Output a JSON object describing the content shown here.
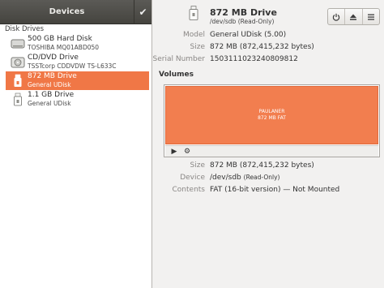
{
  "sidebar": {
    "title": "Devices",
    "section_label": "Disk Drives",
    "items": [
      {
        "name": "500 GB Hard Disk",
        "sub": "TOSHIBA MQ01ABD050",
        "icon": "hard-disk-icon"
      },
      {
        "name": "CD/DVD Drive",
        "sub": "TSSTcorp CDDVDW TS-L633C",
        "icon": "optical-drive-icon"
      },
      {
        "name": "872 MB Drive",
        "sub": "General UDisk",
        "icon": "usb-drive-icon",
        "selected": true
      },
      {
        "name": "1.1 GB Drive",
        "sub": "General UDisk",
        "icon": "usb-drive-icon"
      }
    ]
  },
  "drive": {
    "name": "872 MB Drive",
    "path": "/dev/sdb",
    "path_note": "(Read-Only)"
  },
  "details": {
    "model_label": "Model",
    "model": "General UDisk (5.00)",
    "size_label": "Size",
    "size": "872 MB (872,415,232 bytes)",
    "serial_label": "Serial Number",
    "serial": "1503111023240809812"
  },
  "volumes": {
    "title": "Volumes",
    "segment_name": "PAULANER",
    "segment_desc": "872 MB FAT",
    "size_label": "Size",
    "size": "872 MB (872,415,232 bytes)",
    "device_label": "Device",
    "device": "/dev/sdb",
    "device_note": "(Read-Only)",
    "contents_label": "Contents",
    "contents": "FAT (16-bit version) — Not Mounted"
  },
  "colors": {
    "selection": "#f07746",
    "volume": "#f27e4f"
  }
}
